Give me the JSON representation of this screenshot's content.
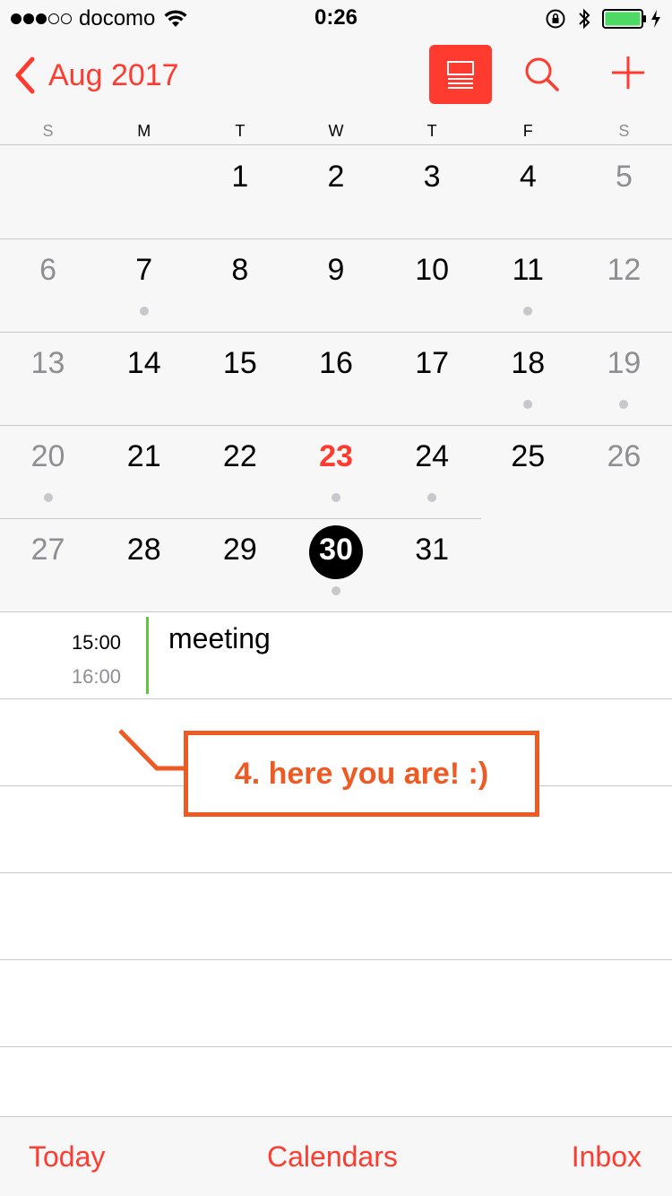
{
  "status_bar": {
    "signal_bars": 3,
    "signal_total": 5,
    "carrier": "docomo",
    "time": "0:26",
    "battery_level": 1.0,
    "charging": true
  },
  "nav": {
    "back_label": "Aug 2017",
    "accent_color": "#ff3b30",
    "icons": [
      "chevron-left-icon",
      "list-view-icon",
      "search-icon",
      "add-icon"
    ]
  },
  "weekdays": [
    {
      "label": "S",
      "weekend": true
    },
    {
      "label": "M",
      "weekend": false
    },
    {
      "label": "T",
      "weekend": false
    },
    {
      "label": "W",
      "weekend": false
    },
    {
      "label": "T",
      "weekend": false
    },
    {
      "label": "F",
      "weekend": false
    },
    {
      "label": "S",
      "weekend": true
    }
  ],
  "month": {
    "first_weekday_index": 2,
    "days": [
      {
        "d": "1"
      },
      {
        "d": "2"
      },
      {
        "d": "3"
      },
      {
        "d": "4"
      },
      {
        "d": "5"
      },
      {
        "d": "6"
      },
      {
        "d": "7",
        "dot": true
      },
      {
        "d": "8"
      },
      {
        "d": "9"
      },
      {
        "d": "10"
      },
      {
        "d": "11",
        "dot": true
      },
      {
        "d": "12"
      },
      {
        "d": "13"
      },
      {
        "d": "14"
      },
      {
        "d": "15"
      },
      {
        "d": "16"
      },
      {
        "d": "17"
      },
      {
        "d": "18",
        "dot": true
      },
      {
        "d": "19",
        "dot": true
      },
      {
        "d": "20",
        "dot": true
      },
      {
        "d": "21"
      },
      {
        "d": "22"
      },
      {
        "d": "23",
        "today": true,
        "dot": true
      },
      {
        "d": "24",
        "dot": true
      },
      {
        "d": "25"
      },
      {
        "d": "26"
      },
      {
        "d": "27"
      },
      {
        "d": "28"
      },
      {
        "d": "29"
      },
      {
        "d": "30",
        "selected": true,
        "dot": true
      },
      {
        "d": "31"
      }
    ]
  },
  "event": {
    "start": "15:00",
    "end": "16:00",
    "title": "meeting",
    "calendar_color": "#5fc63a"
  },
  "annotation": {
    "text": "4.  here you are!  :)",
    "color": "#ee5a24"
  },
  "toolbar": {
    "today": "Today",
    "calendars": "Calendars",
    "inbox": "Inbox"
  }
}
